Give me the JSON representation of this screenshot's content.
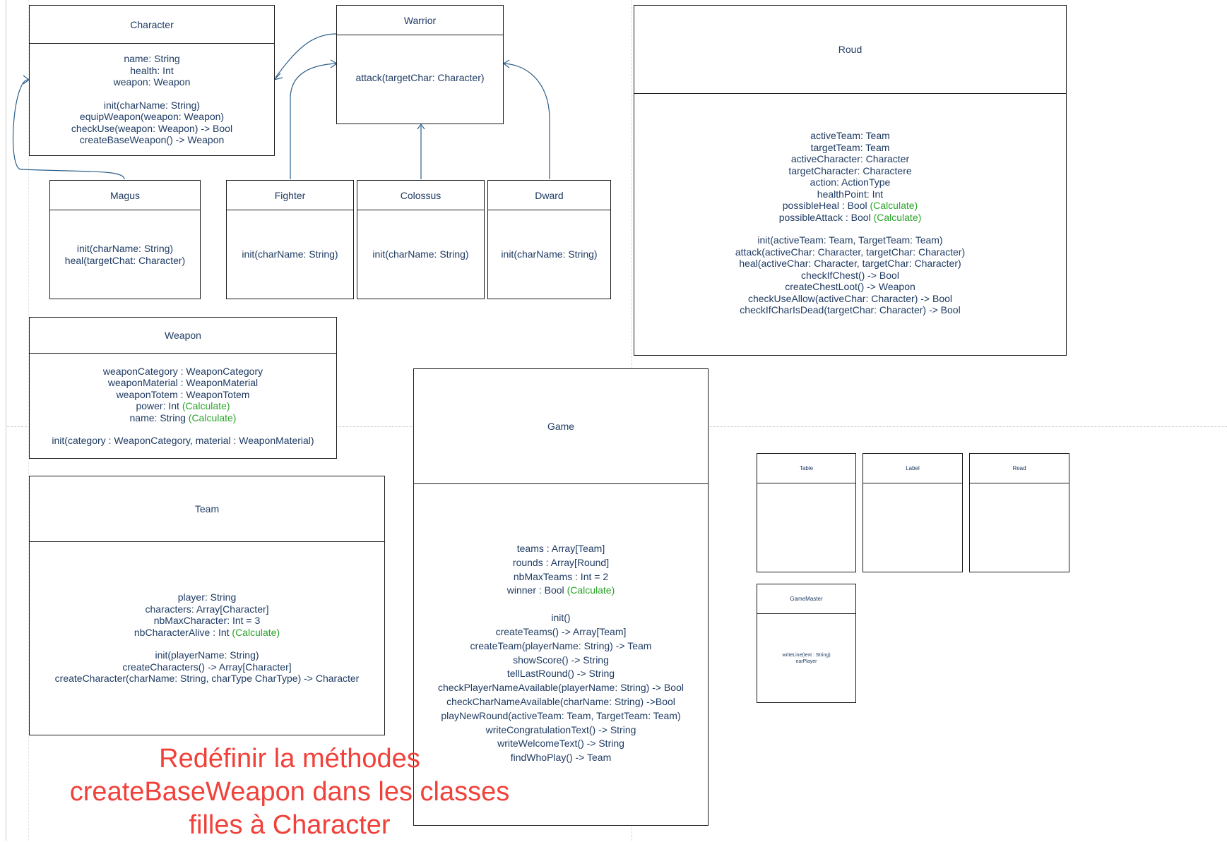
{
  "classes": {
    "character": {
      "name": "Character",
      "lines": [
        "name: String",
        "health: Int",
        "weapon: Weapon",
        "",
        "init(charName: String)",
        "equipWeapon(weapon: Weapon)",
        "checkUse(weapon: Weapon) -> Bool",
        "createBaseWeapon() -> Weapon"
      ]
    },
    "warrior": {
      "name": "Warrior",
      "lines": [
        "attack(targetChar: Character)"
      ]
    },
    "magus": {
      "name": "Magus",
      "lines": [
        "init(charName: String)",
        "heal(targetChat: Character)"
      ]
    },
    "fighter": {
      "name": "Fighter",
      "lines": [
        "init(charName: String)"
      ]
    },
    "colossus": {
      "name": "Colossus",
      "lines": [
        "init(charName: String)"
      ]
    },
    "dward": {
      "name": "Dward",
      "lines": [
        "init(charName: String)"
      ]
    },
    "roud": {
      "name": "Roud",
      "lines": [
        "activeTeam: Team",
        "targetTeam: Team",
        "activeCharacter: Character",
        "targetCharacter: Charactere",
        "action: ActionType",
        "healthPoint: Int",
        "possibleHeal : Bool",
        "possibleAttack : Bool",
        "",
        "init(activeTeam: Team, TargetTeam: Team)",
        "attack(activeChar: Character, targetChar: Character)",
        "heal(activeChar: Character, targetChar: Character)",
        "checkIfChest() -> Bool",
        "createChestLoot() -> Weapon",
        "checkUseAllow(activeChar: Character) -> Bool",
        "checkIfCharIsDead(targetChar: Character) -> Bool"
      ],
      "calc_note": "(Calculate)"
    },
    "weapon": {
      "name": "Weapon",
      "lines": [
        "weaponCategory : WeaponCategory",
        "weaponMaterial : WeaponMaterial",
        "weaponTotem : WeaponTotem",
        "power: Int",
        "name: String",
        "",
        "init(category : WeaponCategory, material : WeaponMaterial)"
      ],
      "calc_note": "(Calculate)"
    },
    "team": {
      "name": "Team",
      "lines": [
        "player: String",
        "characters: Array[Character]",
        "nbMaxCharacter: Int = 3",
        "nbCharacterAlive : Int",
        "",
        "init(playerName: String)",
        "createCharacters() -> Array[Character]",
        "createCharacter(charName: String, charType CharType) -> Character"
      ],
      "calc_note": "(Calculate)"
    },
    "game": {
      "name": "Game",
      "lines": [
        "teams : Array[Team]",
        "rounds : Array[Round]",
        "nbMaxTeams : Int = 2",
        "winner : Bool",
        "",
        "init()",
        "createTeams() -> Array[Team]",
        "createTeam(playerName: String) -> Team",
        "showScore() -> String",
        "tellLastRound() -> String",
        "checkPlayerNameAvailable(playerName: String) -> Bool",
        "checkCharNameAvailable(charName: String) ->Bool",
        "playNewRound(activeTeam: Team, TargetTeam: Team)",
        "writeCongratulationText() -> String",
        "writeWelcomeText() -> String",
        "findWhoPlay() -> Team"
      ],
      "calc_note": "(Calculate)"
    },
    "table": {
      "name": "Table",
      "lines": []
    },
    "label": {
      "name": "Label",
      "lines": []
    },
    "read": {
      "name": "Read",
      "lines": []
    },
    "gamemaster": {
      "name": "GameMaster",
      "lines": [
        "writeLine(text : String)",
        "earPlayer"
      ]
    }
  },
  "note": {
    "text": "Redéfinir la méthodes createBaseWeapon dans les classes filles à Character",
    "color": "#f0413a"
  },
  "colors": {
    "text": "#1f3b63",
    "calculate": "#2aa32a",
    "border": "#1a1a1a",
    "arrow": "#2b5f8a"
  }
}
